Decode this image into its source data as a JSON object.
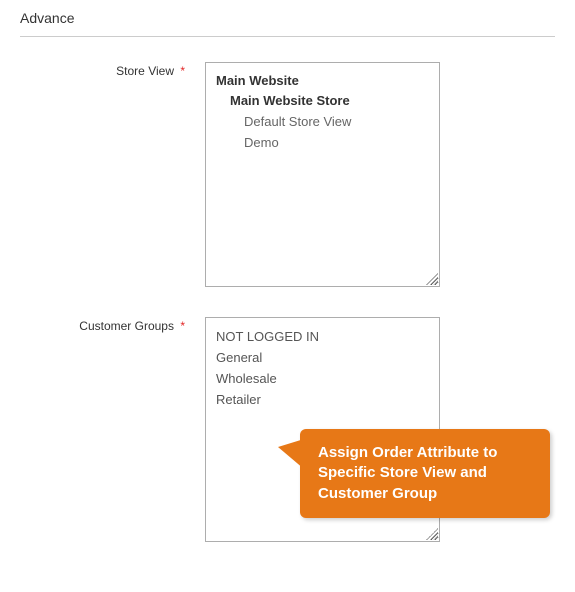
{
  "section": {
    "title": "Advance"
  },
  "fields": {
    "store_view": {
      "label": "Store View",
      "required": "*",
      "options": {
        "website": "Main Website",
        "store": "Main Website Store",
        "views": [
          "Default Store View",
          "Demo"
        ]
      }
    },
    "customer_groups": {
      "label": "Customer Groups",
      "required": "*",
      "options": [
        "NOT LOGGED IN",
        "General",
        "Wholesale",
        "Retailer"
      ]
    }
  },
  "callout": {
    "text": "Assign Order Attribute to Specific Store View and Customer Group",
    "color": "#e77817"
  }
}
